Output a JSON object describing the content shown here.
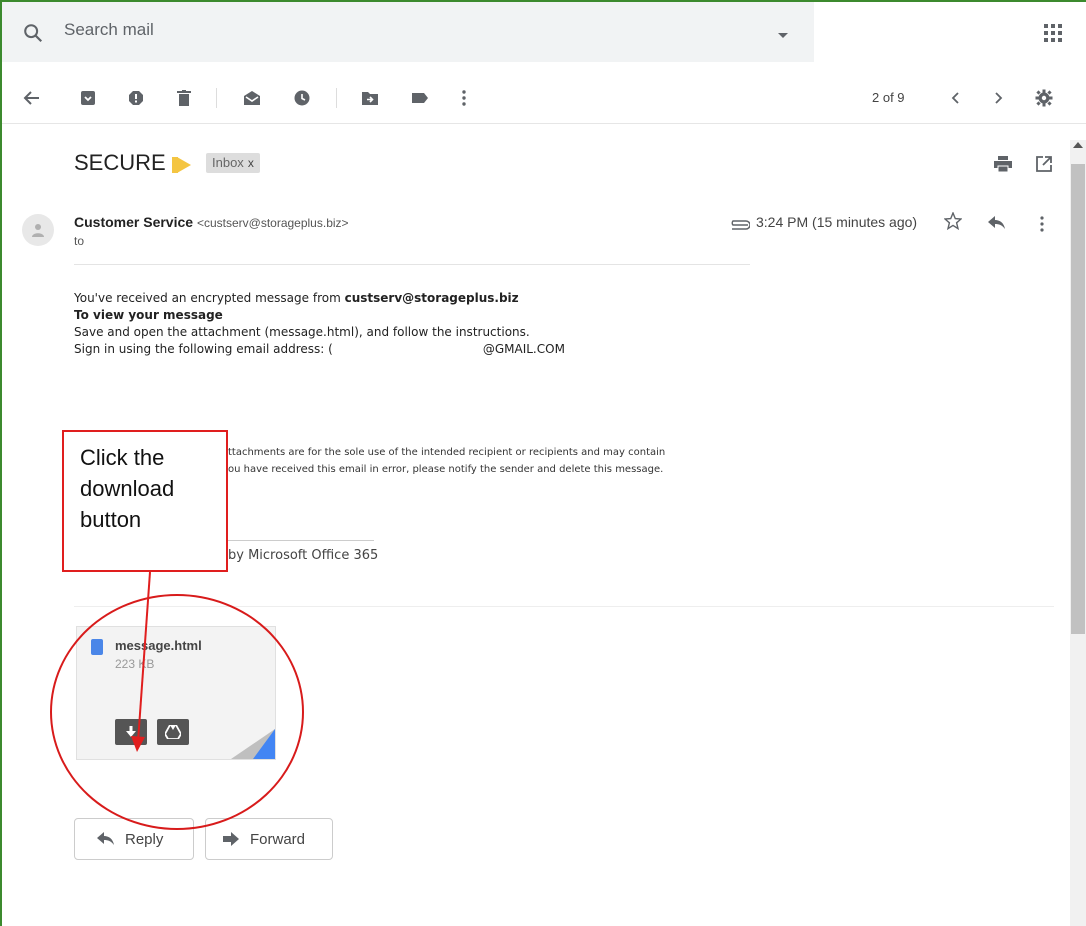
{
  "search": {
    "placeholder": "Search mail"
  },
  "toolbar": {
    "pager": "2 of 9"
  },
  "email": {
    "subject": "SECURE",
    "label": "Inbox",
    "label_close": "x",
    "sender_name": "Customer Service",
    "sender_email": "<custserv@storageplus.biz>",
    "to": "to",
    "time": "3:24 PM (15 minutes ago)",
    "body": {
      "line1_prefix": "You've received an encrypted message from ",
      "line1_bold": "custserv@storageplus.biz",
      "line2": "To view your message",
      "line3": "Save and open the attachment (message.html), and follow the instructions.",
      "line4_prefix": "Sign in using the following email address: (",
      "line4_suffix": "@GMAIL.COM",
      "disclaimer1": "ttachments are for the sole use of the intended recipient or recipients and may contain",
      "disclaimer2": "ou have received this email in error, please notify the sender and delete this message.",
      "footer": "by Microsoft Office 365"
    }
  },
  "attachment": {
    "name": "message.html",
    "size": "223 KB"
  },
  "actions": {
    "reply": "Reply",
    "forward": "Forward"
  },
  "annotation": {
    "callout": "Click the download button"
  },
  "colors": {
    "label": "#f4c542",
    "annotation": "#e01e1e",
    "file": "#4a86e8"
  }
}
